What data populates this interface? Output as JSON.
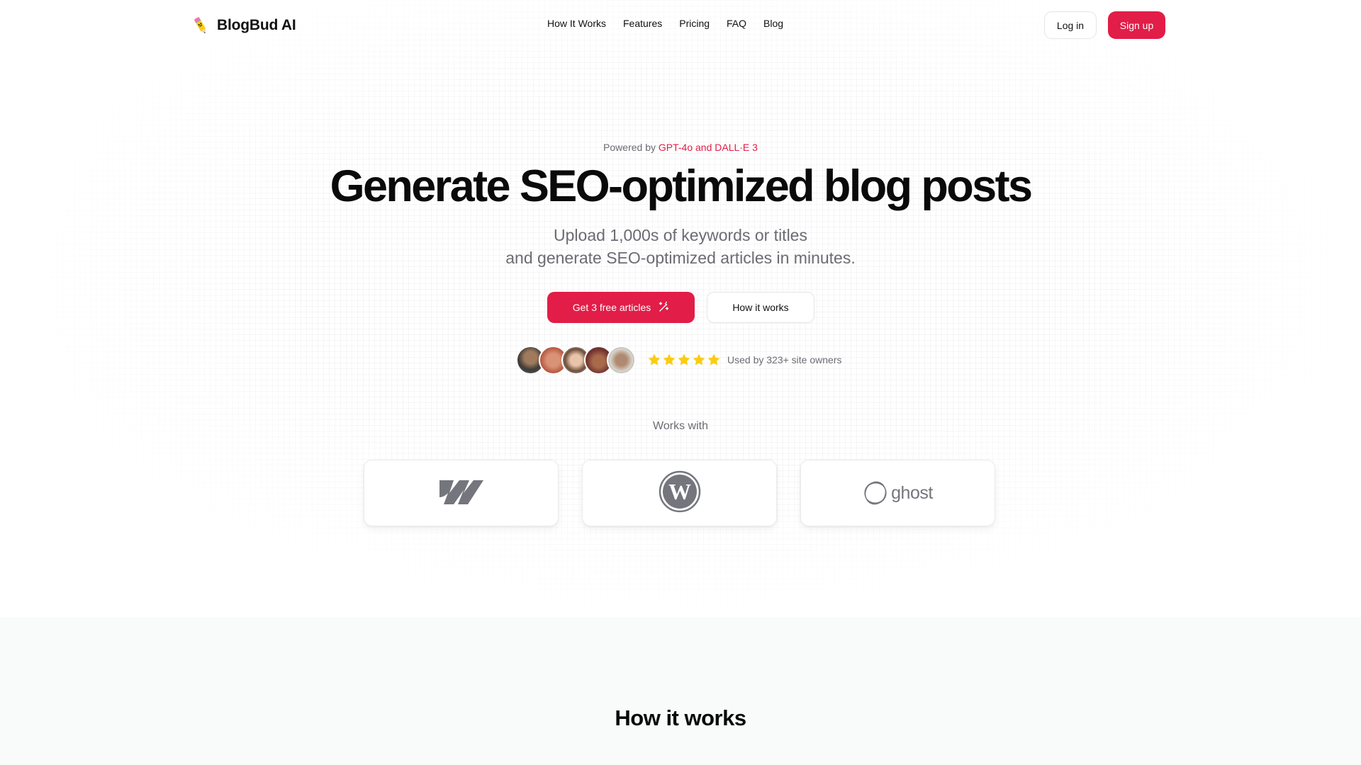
{
  "nav": {
    "brand_name": "BlogBud AI",
    "brand_icon": "pencil-mascot-icon",
    "links": [
      {
        "label": "How It Works"
      },
      {
        "label": "Features"
      },
      {
        "label": "Pricing"
      },
      {
        "label": "FAQ"
      },
      {
        "label": "Blog"
      }
    ],
    "login_label": "Log in",
    "signup_label": "Sign up"
  },
  "hero": {
    "powered_prefix": "Powered by ",
    "powered_models": "GPT-4o and DALL·E 3",
    "headline": "Generate SEO-optimized blog posts",
    "subhead_line1": "Upload 1,000s of keywords or titles",
    "subhead_line2": "and generate SEO-optimized articles in minutes.",
    "primary_cta": "Get 3 free articles",
    "primary_cta_icon": "magic-wand-icon",
    "secondary_cta": "How it works",
    "rating_stars": 5,
    "rating_max": 5,
    "used_by": "Used by 323+ site owners",
    "avatar_count": 5
  },
  "integrations": {
    "label": "Works with",
    "items": [
      {
        "name": "Webflow",
        "icon": "webflow-logo-icon"
      },
      {
        "name": "WordPress",
        "icon": "wordpress-logo-icon"
      },
      {
        "name": "Ghost",
        "icon": "ghost-logo-icon",
        "wordmark": "ghost"
      }
    ]
  },
  "how_it_works": {
    "title": "How it works"
  },
  "colors": {
    "accent": "#e11d48",
    "text": "#0a0a0a",
    "muted": "#6b6b73",
    "star": "#facc15",
    "logo_gray": "#75757d"
  }
}
